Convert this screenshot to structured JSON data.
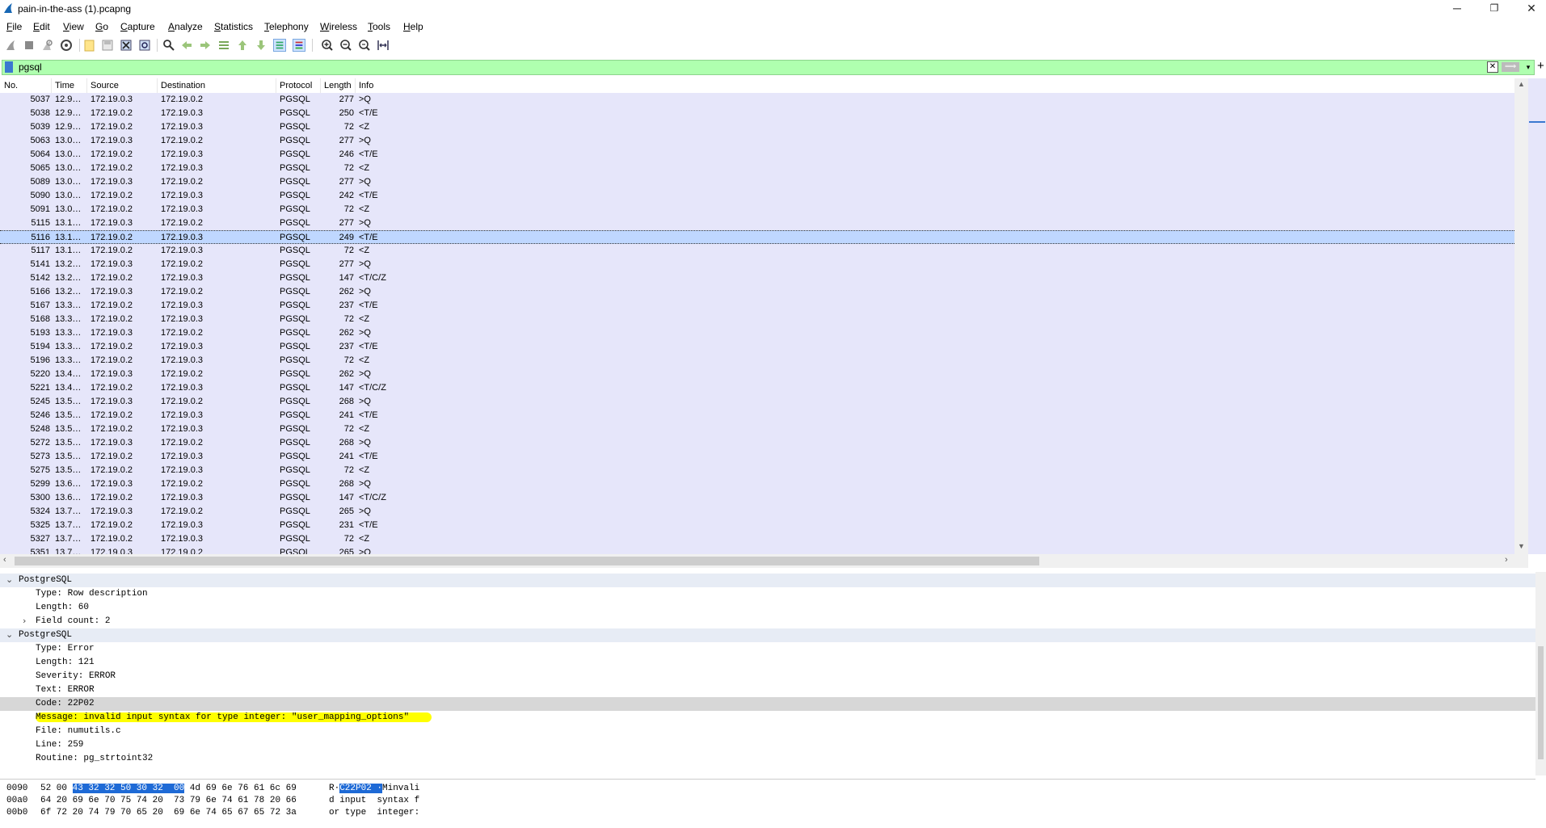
{
  "window": {
    "title": "pain-in-the-ass (1).pcapng",
    "controls": [
      "─",
      "❐",
      "✕"
    ]
  },
  "menu": [
    "File",
    "Edit",
    "View",
    "Go",
    "Capture",
    "Analyze",
    "Statistics",
    "Telephony",
    "Wireless",
    "Tools",
    "Help"
  ],
  "toolbar": {
    "icons": [
      "start-capture-icon",
      "stop-capture-icon",
      "restart-capture-icon",
      "capture-options-icon",
      "open-file-icon",
      "save-file-icon",
      "close-file-icon",
      "reload-file-icon",
      "find-packet-icon",
      "go-back-icon",
      "go-forward-icon",
      "go-to-packet-icon",
      "go-first-icon",
      "go-last-icon",
      "auto-scroll-icon",
      "colorize-icon",
      "zoom-in-icon",
      "zoom-out-icon",
      "normal-size-icon",
      "resize-columns-icon"
    ]
  },
  "filter": {
    "value": "pgsql",
    "plus": "+"
  },
  "packet_list": {
    "columns": [
      "No.",
      "Time",
      "Source",
      "Destination",
      "Protocol",
      "Length",
      "Info"
    ],
    "selected_index": 10,
    "rows": [
      {
        "no": "5037",
        "time": "12.9…",
        "src": "172.19.0.3",
        "dst": "172.19.0.2",
        "proto": "PGSQL",
        "len": "277",
        "info": ">Q"
      },
      {
        "no": "5038",
        "time": "12.9…",
        "src": "172.19.0.2",
        "dst": "172.19.0.3",
        "proto": "PGSQL",
        "len": "250",
        "info": "<T/E"
      },
      {
        "no": "5039",
        "time": "12.9…",
        "src": "172.19.0.2",
        "dst": "172.19.0.3",
        "proto": "PGSQL",
        "len": "72",
        "info": "<Z"
      },
      {
        "no": "5063",
        "time": "13.0…",
        "src": "172.19.0.3",
        "dst": "172.19.0.2",
        "proto": "PGSQL",
        "len": "277",
        "info": ">Q"
      },
      {
        "no": "5064",
        "time": "13.0…",
        "src": "172.19.0.2",
        "dst": "172.19.0.3",
        "proto": "PGSQL",
        "len": "246",
        "info": "<T/E"
      },
      {
        "no": "5065",
        "time": "13.0…",
        "src": "172.19.0.2",
        "dst": "172.19.0.3",
        "proto": "PGSQL",
        "len": "72",
        "info": "<Z"
      },
      {
        "no": "5089",
        "time": "13.0…",
        "src": "172.19.0.3",
        "dst": "172.19.0.2",
        "proto": "PGSQL",
        "len": "277",
        "info": ">Q"
      },
      {
        "no": "5090",
        "time": "13.0…",
        "src": "172.19.0.2",
        "dst": "172.19.0.3",
        "proto": "PGSQL",
        "len": "242",
        "info": "<T/E"
      },
      {
        "no": "5091",
        "time": "13.0…",
        "src": "172.19.0.2",
        "dst": "172.19.0.3",
        "proto": "PGSQL",
        "len": "72",
        "info": "<Z"
      },
      {
        "no": "5115",
        "time": "13.1…",
        "src": "172.19.0.3",
        "dst": "172.19.0.2",
        "proto": "PGSQL",
        "len": "277",
        "info": ">Q"
      },
      {
        "no": "5116",
        "time": "13.1…",
        "src": "172.19.0.2",
        "dst": "172.19.0.3",
        "proto": "PGSQL",
        "len": "249",
        "info": "<T/E"
      },
      {
        "no": "5117",
        "time": "13.1…",
        "src": "172.19.0.2",
        "dst": "172.19.0.3",
        "proto": "PGSQL",
        "len": "72",
        "info": "<Z"
      },
      {
        "no": "5141",
        "time": "13.2…",
        "src": "172.19.0.3",
        "dst": "172.19.0.2",
        "proto": "PGSQL",
        "len": "277",
        "info": ">Q"
      },
      {
        "no": "5142",
        "time": "13.2…",
        "src": "172.19.0.2",
        "dst": "172.19.0.3",
        "proto": "PGSQL",
        "len": "147",
        "info": "<T/C/Z"
      },
      {
        "no": "5166",
        "time": "13.2…",
        "src": "172.19.0.3",
        "dst": "172.19.0.2",
        "proto": "PGSQL",
        "len": "262",
        "info": ">Q"
      },
      {
        "no": "5167",
        "time": "13.3…",
        "src": "172.19.0.2",
        "dst": "172.19.0.3",
        "proto": "PGSQL",
        "len": "237",
        "info": "<T/E"
      },
      {
        "no": "5168",
        "time": "13.3…",
        "src": "172.19.0.2",
        "dst": "172.19.0.3",
        "proto": "PGSQL",
        "len": "72",
        "info": "<Z"
      },
      {
        "no": "5193",
        "time": "13.3…",
        "src": "172.19.0.3",
        "dst": "172.19.0.2",
        "proto": "PGSQL",
        "len": "262",
        "info": ">Q"
      },
      {
        "no": "5194",
        "time": "13.3…",
        "src": "172.19.0.2",
        "dst": "172.19.0.3",
        "proto": "PGSQL",
        "len": "237",
        "info": "<T/E"
      },
      {
        "no": "5196",
        "time": "13.3…",
        "src": "172.19.0.2",
        "dst": "172.19.0.3",
        "proto": "PGSQL",
        "len": "72",
        "info": "<Z"
      },
      {
        "no": "5220",
        "time": "13.4…",
        "src": "172.19.0.3",
        "dst": "172.19.0.2",
        "proto": "PGSQL",
        "len": "262",
        "info": ">Q"
      },
      {
        "no": "5221",
        "time": "13.4…",
        "src": "172.19.0.2",
        "dst": "172.19.0.3",
        "proto": "PGSQL",
        "len": "147",
        "info": "<T/C/Z"
      },
      {
        "no": "5245",
        "time": "13.5…",
        "src": "172.19.0.3",
        "dst": "172.19.0.2",
        "proto": "PGSQL",
        "len": "268",
        "info": ">Q"
      },
      {
        "no": "5246",
        "time": "13.5…",
        "src": "172.19.0.2",
        "dst": "172.19.0.3",
        "proto": "PGSQL",
        "len": "241",
        "info": "<T/E"
      },
      {
        "no": "5248",
        "time": "13.5…",
        "src": "172.19.0.2",
        "dst": "172.19.0.3",
        "proto": "PGSQL",
        "len": "72",
        "info": "<Z"
      },
      {
        "no": "5272",
        "time": "13.5…",
        "src": "172.19.0.3",
        "dst": "172.19.0.2",
        "proto": "PGSQL",
        "len": "268",
        "info": ">Q"
      },
      {
        "no": "5273",
        "time": "13.5…",
        "src": "172.19.0.2",
        "dst": "172.19.0.3",
        "proto": "PGSQL",
        "len": "241",
        "info": "<T/E"
      },
      {
        "no": "5275",
        "time": "13.5…",
        "src": "172.19.0.2",
        "dst": "172.19.0.3",
        "proto": "PGSQL",
        "len": "72",
        "info": "<Z"
      },
      {
        "no": "5299",
        "time": "13.6…",
        "src": "172.19.0.3",
        "dst": "172.19.0.2",
        "proto": "PGSQL",
        "len": "268",
        "info": ">Q"
      },
      {
        "no": "5300",
        "time": "13.6…",
        "src": "172.19.0.2",
        "dst": "172.19.0.3",
        "proto": "PGSQL",
        "len": "147",
        "info": "<T/C/Z"
      },
      {
        "no": "5324",
        "time": "13.7…",
        "src": "172.19.0.3",
        "dst": "172.19.0.2",
        "proto": "PGSQL",
        "len": "265",
        "info": ">Q"
      },
      {
        "no": "5325",
        "time": "13.7…",
        "src": "172.19.0.2",
        "dst": "172.19.0.3",
        "proto": "PGSQL",
        "len": "231",
        "info": "<T/E"
      },
      {
        "no": "5327",
        "time": "13.7…",
        "src": "172.19.0.2",
        "dst": "172.19.0.3",
        "proto": "PGSQL",
        "len": "72",
        "info": "<Z"
      },
      {
        "no": "5351",
        "time": "13.7…",
        "src": "172.19.0.3",
        "dst": "172.19.0.2",
        "proto": "PGSQL",
        "len": "265",
        "info": ">Q"
      }
    ]
  },
  "details": {
    "lines": [
      {
        "text": "PostgreSQL",
        "indent": 0,
        "caret": "expanded",
        "style": "hdr"
      },
      {
        "text": "Type: Row description",
        "indent": 1
      },
      {
        "text": "Length: 60",
        "indent": 1
      },
      {
        "text": "Field count: 2",
        "indent": 1,
        "caret": "collapsed"
      },
      {
        "text": "PostgreSQL",
        "indent": 0,
        "caret": "expanded",
        "style": "hdr"
      },
      {
        "text": "Type: Error",
        "indent": 1
      },
      {
        "text": "Length: 121",
        "indent": 1
      },
      {
        "text": "Severity: ERROR",
        "indent": 1
      },
      {
        "text": "Text: ERROR",
        "indent": 1
      },
      {
        "text": "Code: 22P02",
        "indent": 1,
        "style": "gray"
      },
      {
        "text": "Message: invalid input syntax for type integer: \"user_mapping_options\"",
        "indent": 1,
        "style": "highlight"
      },
      {
        "text": "File: numutils.c",
        "indent": 1
      },
      {
        "text": "Line: 259",
        "indent": 1
      },
      {
        "text": "Routine: pg_strtoint32",
        "indent": 1
      }
    ]
  },
  "hex": {
    "lines": [
      {
        "offset": "0090",
        "pre": "52 00 ",
        "sel": "43 32 32 50 30 32  00",
        "post": " 4d 69 6e 76 61 6c 69",
        "apre": "R·",
        "asel": "C22P02 ·",
        "apost": "Minvali"
      },
      {
        "offset": "00a0",
        "pre": "64 20 69 6e 70 75 74 20  73 79 6e 74 61 78 20 66",
        "sel": "",
        "post": "",
        "apre": "d input  syntax f",
        "asel": "",
        "apost": ""
      },
      {
        "offset": "00b0",
        "pre": "6f 72 20 74 79 70 65 20  69 6e 74 65 67 65 72 3a",
        "sel": "",
        "post": "",
        "apre": "or type  integer:",
        "asel": "",
        "apost": ""
      }
    ]
  },
  "colors": {
    "list_bg": "#e6e6fa",
    "selected_row": "#bfd7ff",
    "filter_bg": "#afffaf",
    "highlight": "#ffff00"
  }
}
